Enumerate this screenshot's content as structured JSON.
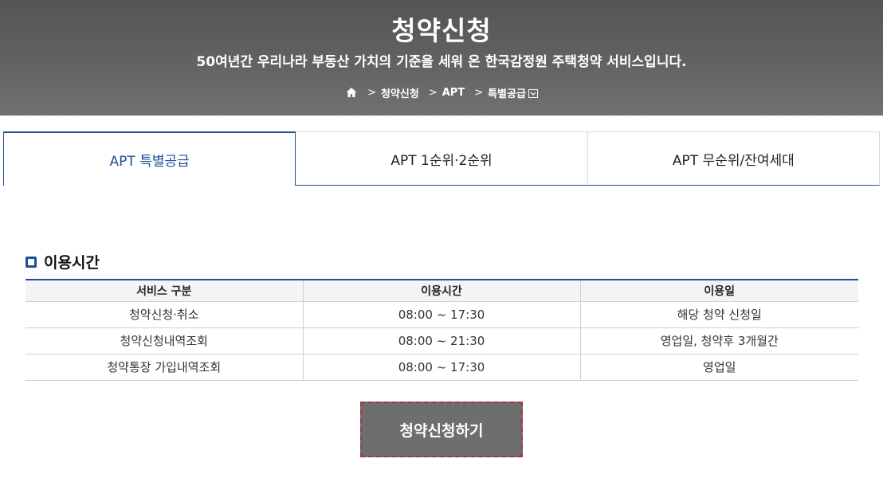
{
  "header": {
    "title": "청약신청",
    "subtitle": "50여년간 우리나라 부동산 가치의 기준을 세워 온 한국감정원 주택청약 서비스입니다.",
    "breadcrumb": [
      "청약신청",
      "APT",
      "특별공급"
    ],
    "home_icon": "home-icon",
    "dropdown_icon": "chevron-down-icon"
  },
  "tabs": [
    {
      "label": "APT 특별공급",
      "active": true
    },
    {
      "label": "APT 1순위·2순위",
      "active": false
    },
    {
      "label": "APT 무순위/잔여세대",
      "active": false
    }
  ],
  "usage": {
    "title": "이용시간",
    "columns": [
      "서비스 구분",
      "이용시간",
      "이용일"
    ],
    "rows": [
      [
        "청약신청·취소",
        "08:00 ~ 17:30",
        "해당 청약 신청일"
      ],
      [
        "청약신청내역조회",
        "08:00 ~ 21:30",
        "영업일, 청약후 3개월간"
      ],
      [
        "청약통장 가입내역조회",
        "08:00 ~ 17:30",
        "영업일"
      ]
    ]
  },
  "apply_button": {
    "label": "청약신청하기"
  },
  "colors": {
    "accent": "#1f4e96",
    "hero_bg": "#5c5d5e",
    "button_bg": "#6e6e6e",
    "button_focus_border": "#a8323c"
  }
}
